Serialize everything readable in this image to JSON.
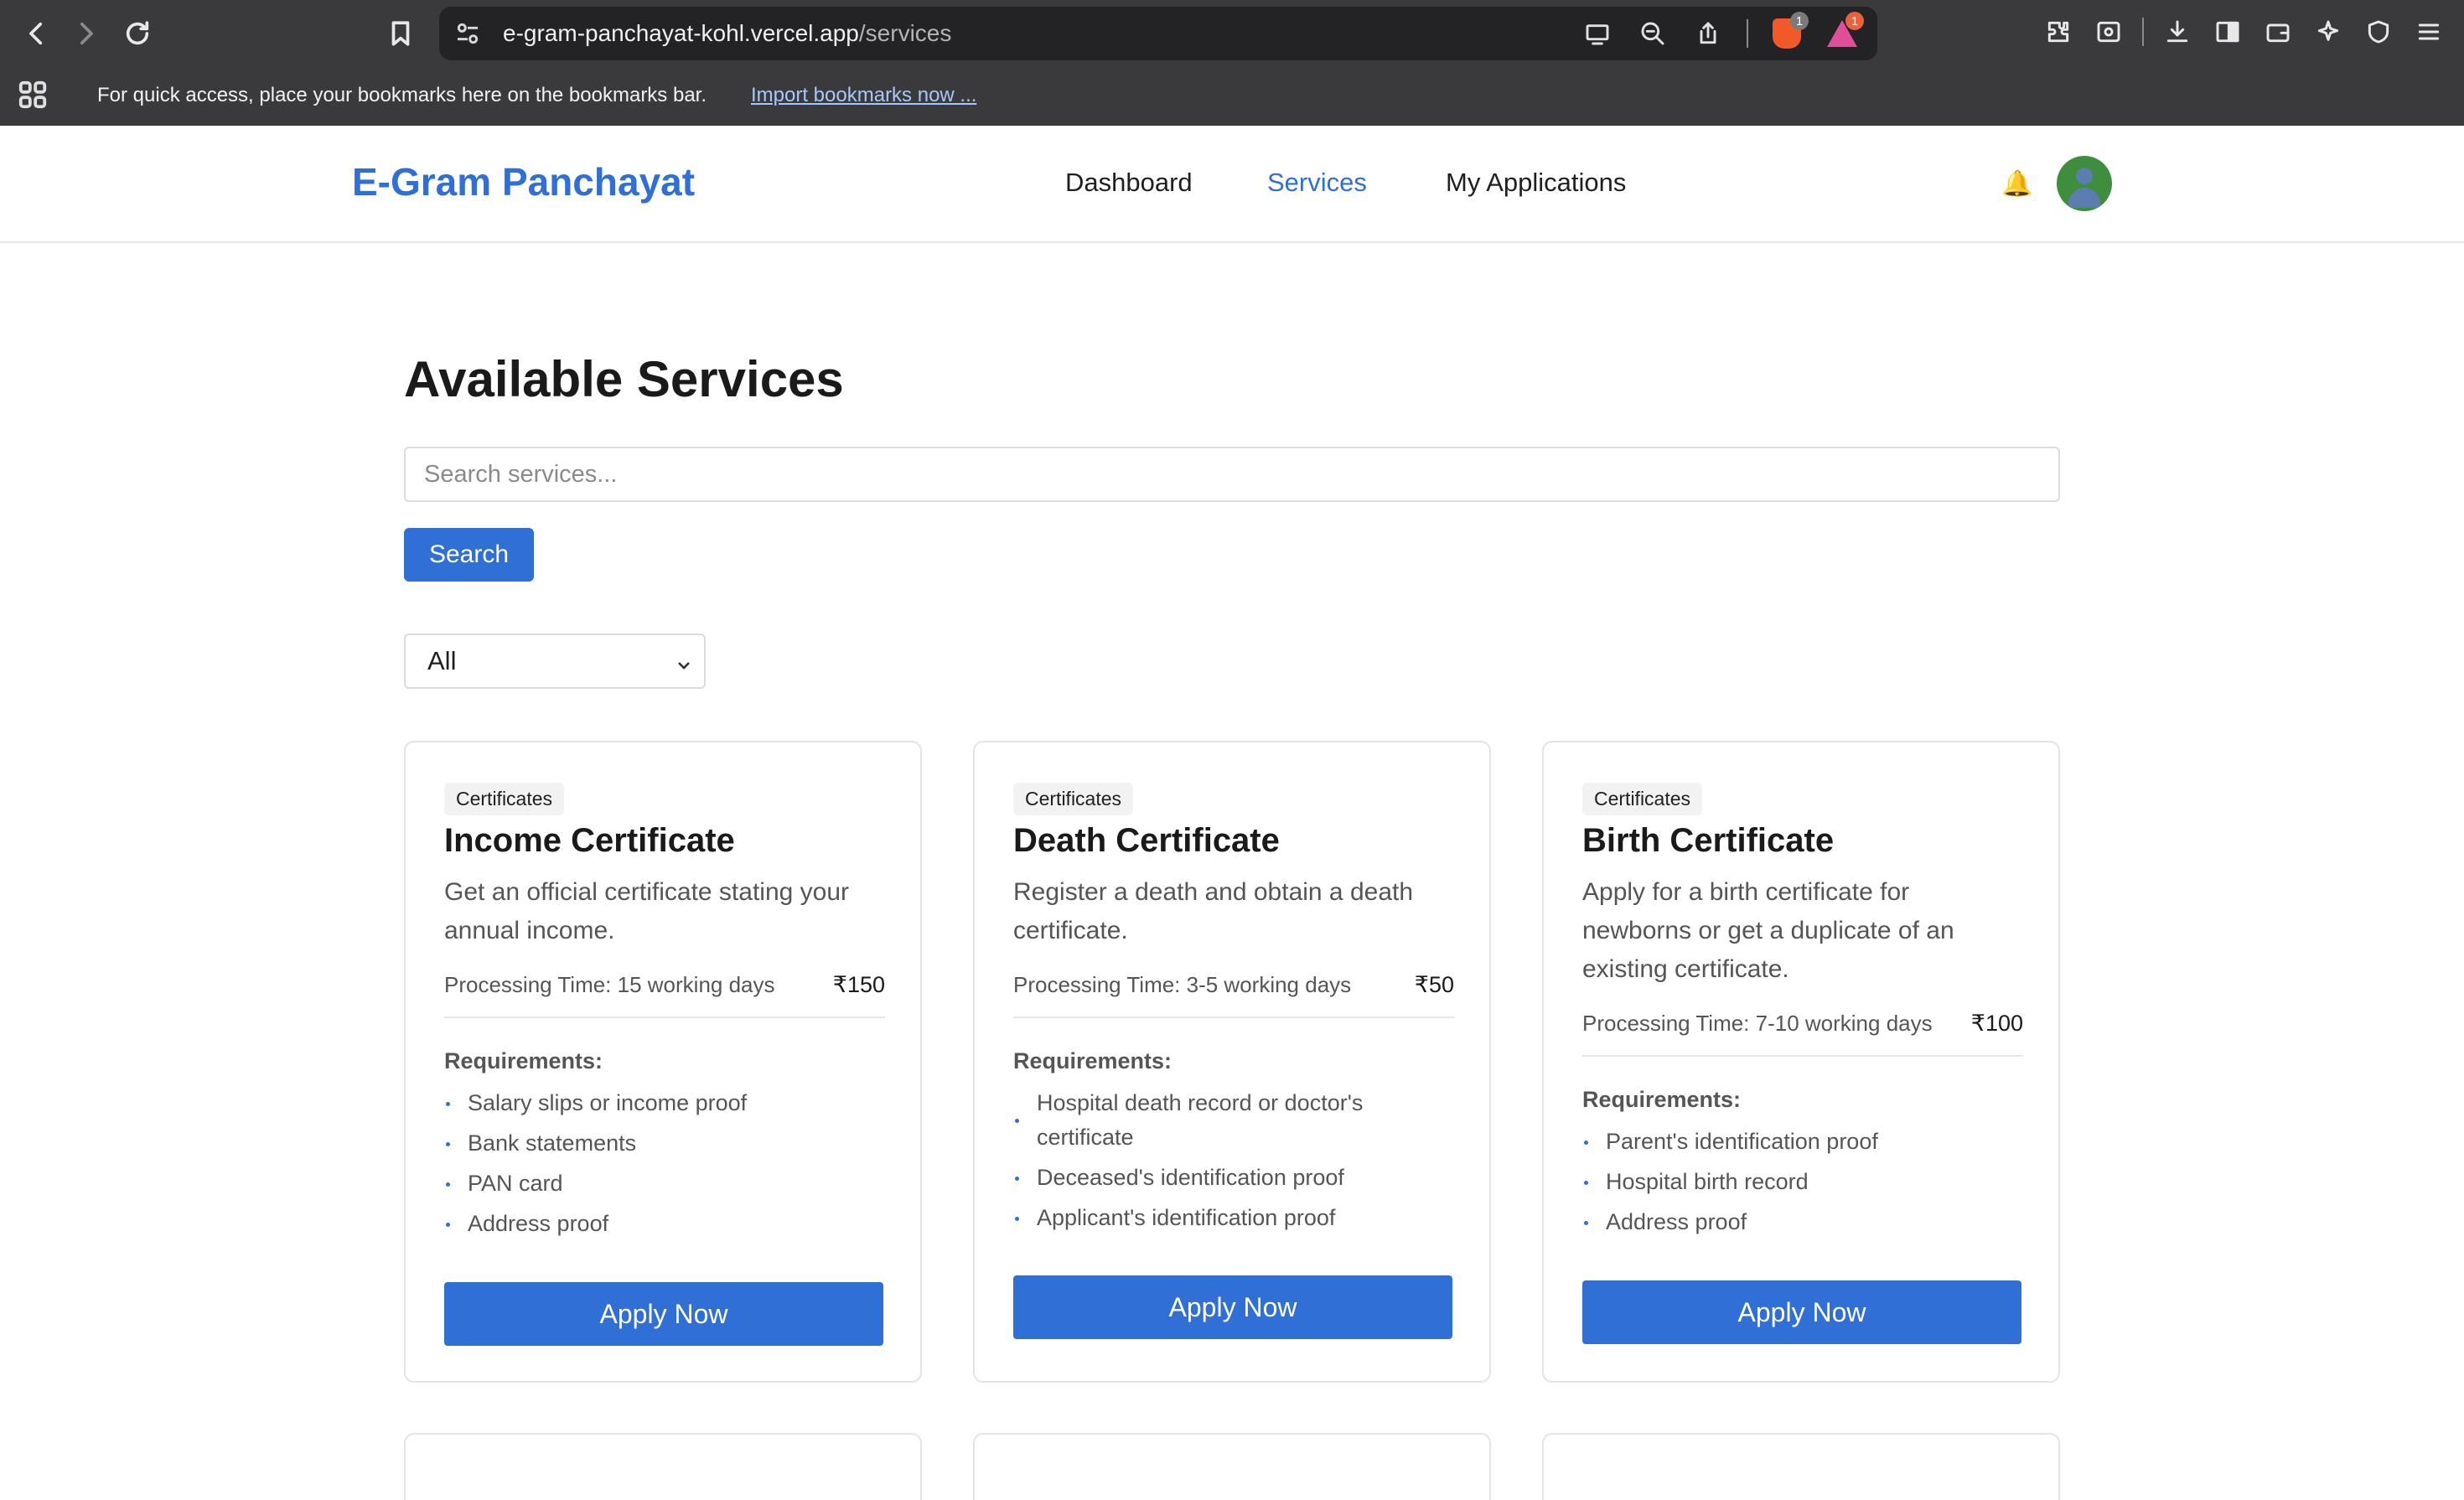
{
  "browser": {
    "url_host": "e-gram-panchayat-kohl.vercel.app",
    "url_path": "/services",
    "brave_badge": "1",
    "rewards_badge": "1",
    "bookmarks_message": "For quick access, place your bookmarks here on the bookmarks bar.",
    "import_link": "Import bookmarks now ..."
  },
  "header": {
    "brand": "E-Gram Panchayat",
    "nav": [
      {
        "label": "Dashboard",
        "active": false
      },
      {
        "label": "Services",
        "active": true
      },
      {
        "label": "My Applications",
        "active": false
      }
    ],
    "bell_icon": "bell-icon"
  },
  "main": {
    "title": "Available Services",
    "search_placeholder": "Search services...",
    "search_button": "Search",
    "filter_selected": "All",
    "cards": [
      {
        "tag": "Certificates",
        "title": "Income Certificate",
        "description": "Get an official certificate stating your annual income.",
        "processing": "Processing Time: 15 working days",
        "price": "₹150",
        "requirements_label": "Requirements:",
        "requirements": [
          "Salary slips or income proof",
          "Bank statements",
          "PAN card",
          "Address proof"
        ],
        "apply": "Apply Now"
      },
      {
        "tag": "Certificates",
        "title": "Death Certificate",
        "description": "Register a death and obtain a death certificate.",
        "processing": "Processing Time: 3-5 working days",
        "price": "₹50",
        "requirements_label": "Requirements:",
        "requirements": [
          "Hospital death record or doctor's certificate",
          "Deceased's identification proof",
          "Applicant's identification proof"
        ],
        "apply": "Apply Now"
      },
      {
        "tag": "Certificates",
        "title": "Birth Certificate",
        "description": "Apply for a birth certificate for newborns or get a duplicate of an existing certificate.",
        "processing": "Processing Time: 7-10 working days",
        "price": "₹100",
        "requirements_label": "Requirements:",
        "requirements": [
          "Parent's identification proof",
          "Hospital birth record",
          "Address proof"
        ],
        "apply": "Apply Now"
      }
    ]
  },
  "colors": {
    "accent": "#2f6fd6",
    "chrome": "#3a3a3c",
    "avatar": "#3e8e3e"
  }
}
